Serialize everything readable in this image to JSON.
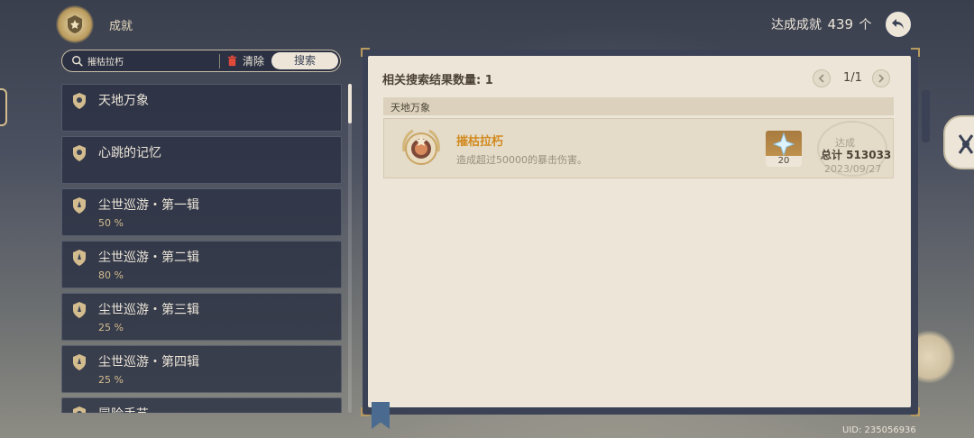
{
  "header": {
    "title": "成就",
    "achieved_label": "达成成就",
    "achieved_count": "439",
    "achieved_unit": "个"
  },
  "search": {
    "value": "摧枯拉朽",
    "clear_label": "清除",
    "button_label": "搜索"
  },
  "categories": [
    {
      "title": "天地万象",
      "progress": ""
    },
    {
      "title": "心跳的记忆",
      "progress": ""
    },
    {
      "title": "尘世巡游・第一辑",
      "progress": "50 %"
    },
    {
      "title": "尘世巡游・第二辑",
      "progress": "80 %"
    },
    {
      "title": "尘世巡游・第三辑",
      "progress": "25 %"
    },
    {
      "title": "尘世巡游・第四辑",
      "progress": "25 %"
    },
    {
      "title": "冒险手艺",
      "progress": ""
    }
  ],
  "results": {
    "title": "相关搜索结果数量: 1",
    "page": "1/1",
    "group": "天地万象",
    "item": {
      "title": "摧枯拉朽",
      "description": "造成超过50000的暴击伤害。",
      "reward_qty": "20",
      "status": "达成",
      "total": "总计 513033",
      "date": "2023/09/27"
    }
  },
  "footer": {
    "uid": "UID: 235056936"
  },
  "colors": {
    "panel_bg": "#ede6d8",
    "frame": "#3b4255",
    "achievement_title": "#d28a1e",
    "gold_accent": "#d3bc8e"
  },
  "icons": {
    "header": "achievement-emblem-icon",
    "back": "back-arrow-icon",
    "search": "search-icon",
    "clear": "trash-icon",
    "reward": "primogem-icon"
  }
}
